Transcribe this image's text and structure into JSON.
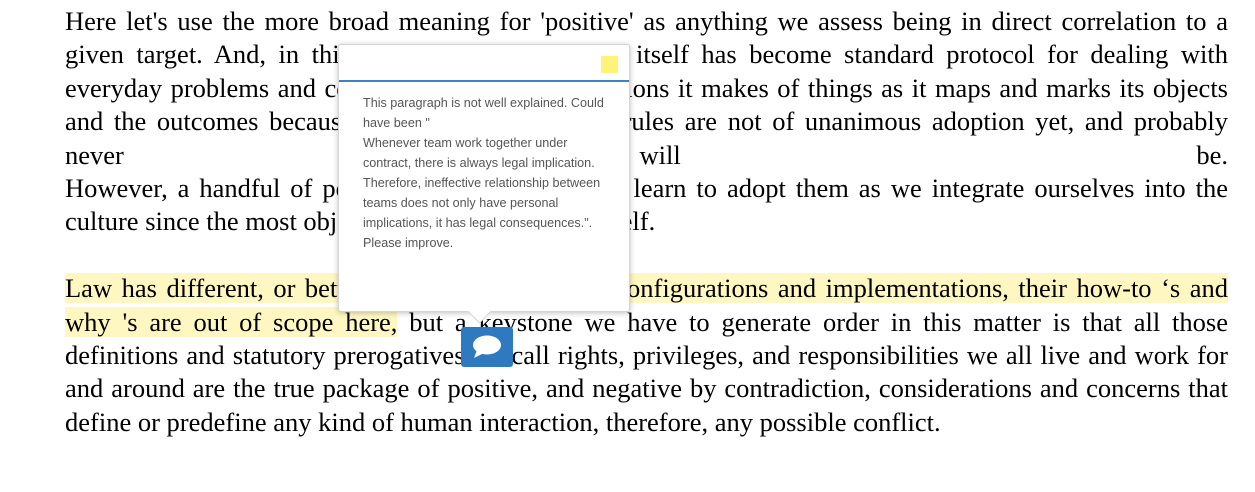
{
  "document": {
    "paragraph1": "Here let's use the more broad meaning for 'positive' as anything we assess being in direct correlation to a given target. And, in this sense, positive thinking itself has become standard protocol for dealing with everyday problems and conflicts through the definitions it makes of things as it maps and marks its objects and the outcomes because it assumes as proposal rules are not of unanimous adoption yet, and probably never will be.",
    "paragraph2": "However, a handful of positive rules exist, and we learn to adopt them as we integrate ourselves into the culture since the most objective of this, is the law itself.",
    "paragraph3_highlighted": "Law has different, or better said multiple cultural configurations and implementations, their how-to ‘s and why 's are out of scope here,",
    "paragraph3_rest": " but a keystone we have to generate order in this matter is that all those definitions and statutory prerogatives we call rights, privileges, and responsibilities we all live and work for and around are the true package of positive, and negative by contradiction, considerations and concerns that define or predefine any kind of human interaction, therefore, any possible conflict."
  },
  "comment": {
    "text": "This paragraph is not well explained. Could have been \"\nWhenever team work together under contract, there is always legal implication. Therefore, ineffective relationship between teams does not only have personal implications, it has legal consequences.\". Please improve.",
    "highlight_color": "#fff37a",
    "accent_color": "#3f82c4",
    "icon": "comment-bubble-icon"
  }
}
